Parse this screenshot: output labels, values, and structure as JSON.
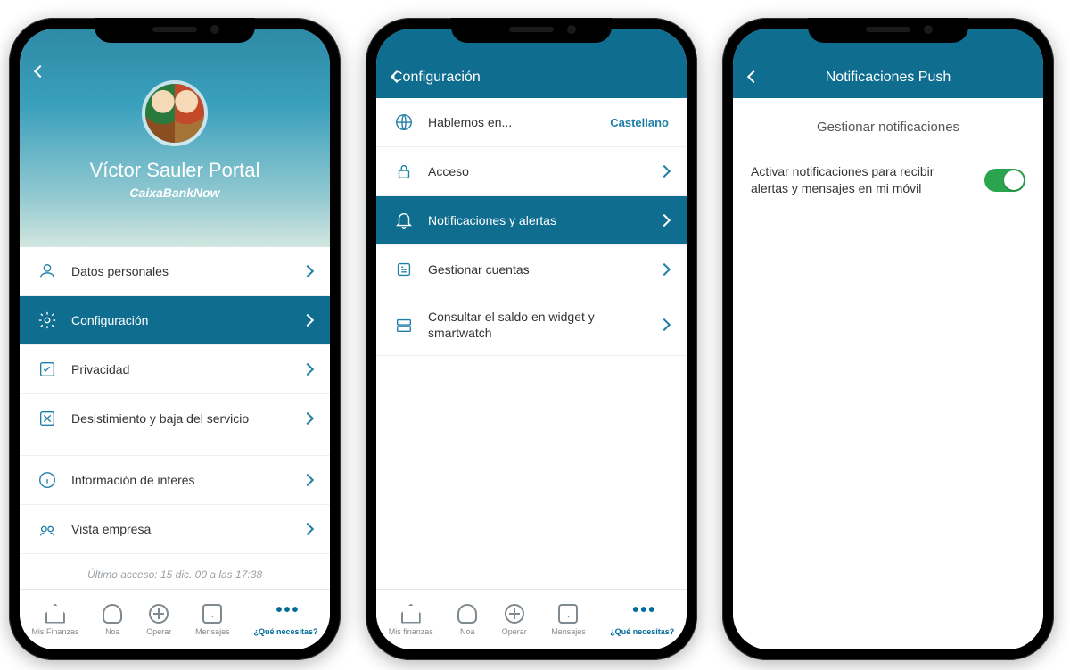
{
  "screen1": {
    "user_name": "Víctor Sauler Portal",
    "app_name": "CaixaBankNow",
    "menu": {
      "personal": "Datos personales",
      "config": "Configuración",
      "privacy": "Privacidad",
      "cancel": "Desistimiento y baja del servicio",
      "info": "Información de interés",
      "biz": "Vista empresa"
    },
    "last_access": "Último acceso: 15 dic. 00 a las 17:38",
    "tabs": {
      "finance": "Mis Finanzas",
      "noa": "Noa",
      "operate": "Operar",
      "messages": "Mensajes",
      "need": "¿Qué necesitas?"
    }
  },
  "screen2": {
    "title": "Configuración",
    "rows": {
      "lang_label": "Hablemos en...",
      "lang_value": "Castellano",
      "access": "Acceso",
      "notif": "Notificaciones y alertas",
      "accounts": "Gestionar cuentas",
      "widget": "Consultar el saldo en widget y smartwatch"
    },
    "tabs": {
      "finance": "Mis finanzas",
      "noa": "Noa",
      "operate": "Operar",
      "messages": "Mensajes",
      "need": "¿Qué necesitas?"
    }
  },
  "screen3": {
    "title": "Notificaciones Push",
    "section": "Gestionar notificaciones",
    "toggle_label": "Activar notificaciones para recibir alertas y mensajes en mi móvil",
    "toggle_on": true
  }
}
